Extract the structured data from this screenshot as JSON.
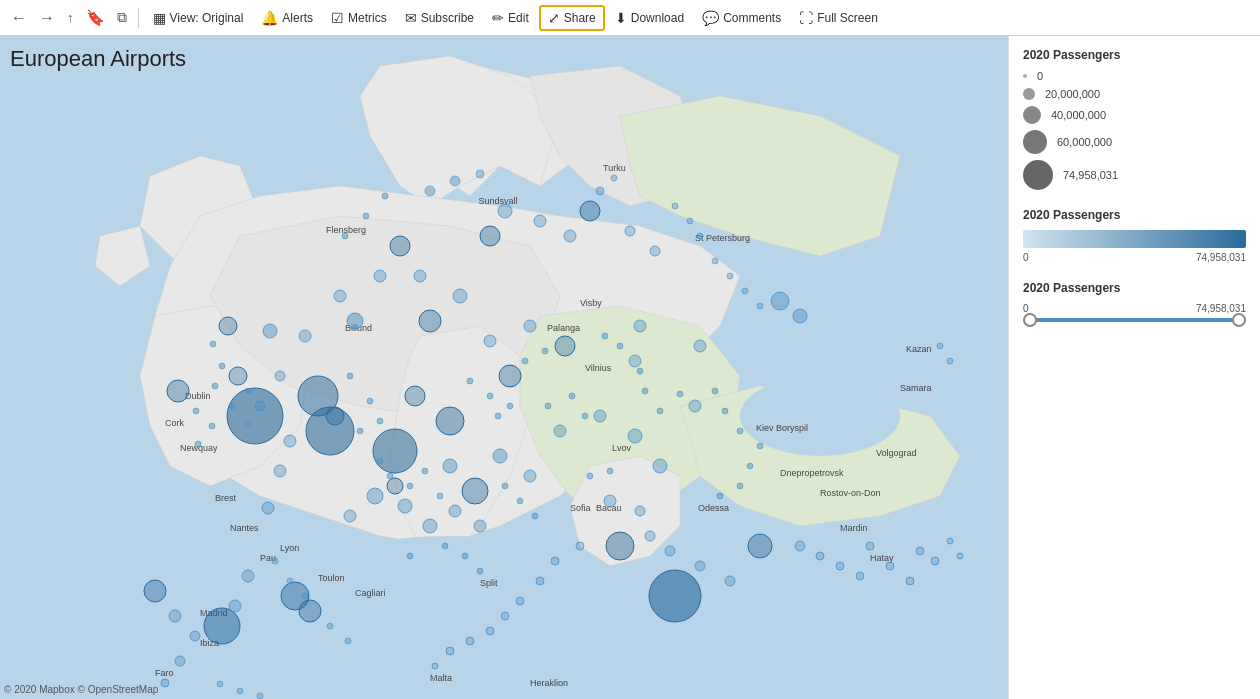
{
  "toolbar": {
    "nav": {
      "back": "←",
      "forward": "→",
      "up": "↑",
      "bookmark": "🔖",
      "share_copy": "⧉"
    },
    "buttons": [
      {
        "id": "view-original",
        "label": "View: Original",
        "icon": "▦",
        "active": false
      },
      {
        "id": "alerts",
        "label": "Alerts",
        "icon": "🔔",
        "active": false
      },
      {
        "id": "metrics",
        "label": "Metrics",
        "icon": "☑",
        "active": false
      },
      {
        "id": "subscribe",
        "label": "Subscribe",
        "icon": "✉",
        "active": false
      },
      {
        "id": "edit",
        "label": "Edit",
        "icon": "✏",
        "active": false
      },
      {
        "id": "share",
        "label": "Share",
        "icon": "⤢",
        "active": true
      },
      {
        "id": "download",
        "label": "Download",
        "icon": "⬇",
        "active": false
      },
      {
        "id": "comments",
        "label": "Comments",
        "icon": "💬",
        "active": false
      },
      {
        "id": "fullscreen",
        "label": "Full Screen",
        "icon": "⛶",
        "active": false
      }
    ]
  },
  "map": {
    "title": "European Airports",
    "credit": "© 2020 Mapbox © OpenStreetMap"
  },
  "legend": {
    "bubble": {
      "title": "2020 Passengers",
      "items": [
        {
          "label": "0",
          "size": 4
        },
        {
          "label": "20,000,000",
          "size": 10
        },
        {
          "label": "40,000,000",
          "size": 16
        },
        {
          "label": "60,000,000",
          "size": 22
        },
        {
          "label": "74,958,031",
          "size": 28
        }
      ]
    },
    "colorbar": {
      "title": "2020 Passengers",
      "min": "0",
      "max": "74,958,031"
    },
    "slider": {
      "title": "2020 Passengers",
      "min": "0",
      "max": "74,958,031"
    }
  }
}
